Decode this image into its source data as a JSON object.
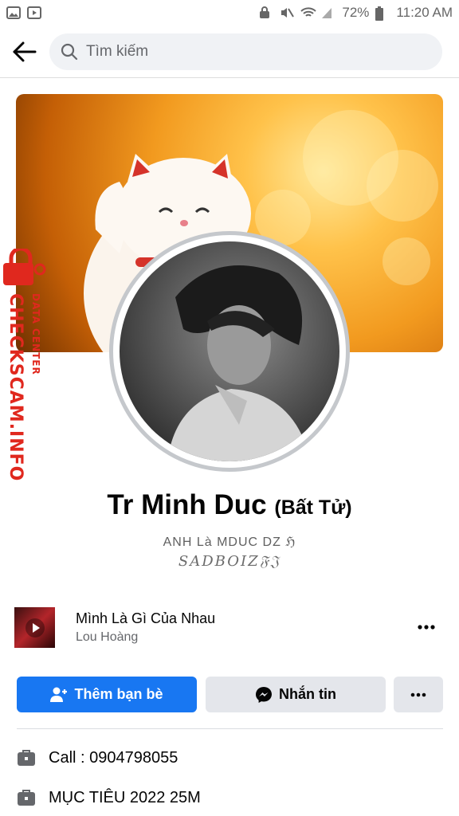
{
  "status_bar": {
    "battery": "72%",
    "time": "11:20 AM"
  },
  "search": {
    "placeholder": "Tìm kiếm"
  },
  "watermark": {
    "brand": "CHECKSCAM.INFO",
    "subtitle": "DATA CENTER"
  },
  "profile": {
    "name": "Tr Minh Duc",
    "nickname": "(Bất Tử)",
    "bio_line1": "ANH Là MDUC DZ ℌ",
    "bio_line2": "SADBOIZ𝔉𝔍"
  },
  "music": {
    "title": "Mình Là Gì Của Nhau",
    "artist": "Lou Hoàng"
  },
  "actions": {
    "add_friend": "Thêm bạn bè",
    "message": "Nhắn tin"
  },
  "info": [
    {
      "text": "Call : 0904798055",
      "icon": "briefcase-icon"
    },
    {
      "text": "MỤC TIÊU 2022 25M",
      "icon": "briefcase-icon"
    }
  ],
  "colors": {
    "primary": "#1877f2",
    "secondary_button": "#e4e6eb",
    "watermark": "#e0281e"
  }
}
